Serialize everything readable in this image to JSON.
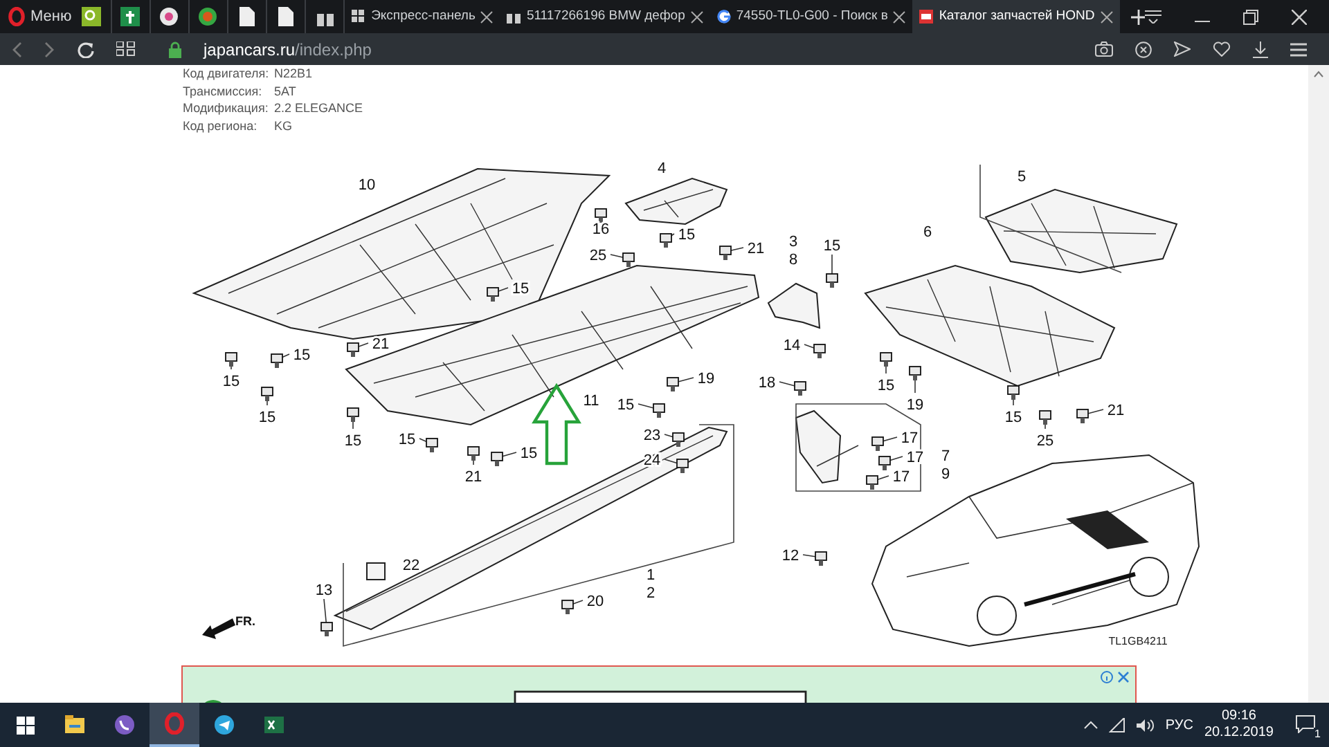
{
  "browser": {
    "menu_label": "Меню",
    "tabs": [
      {
        "title": "Экспресс-панель",
        "kind": "speed-dial",
        "selected": false
      },
      {
        "title": "51117266196 BMW дефор",
        "kind": "site",
        "selected": false
      },
      {
        "title": "74550-TL0-G00 - Поиск в",
        "kind": "google",
        "selected": false
      },
      {
        "title": "Каталог запчастей HOND",
        "kind": "catalog",
        "selected": true
      }
    ],
    "address": {
      "host": "japancars.ru",
      "path": "/index.php"
    }
  },
  "vehicle_info": [
    {
      "label": "Код двигателя:",
      "value": "N22B1"
    },
    {
      "label": "Трансмиссия:",
      "value": "5AT"
    },
    {
      "label": "Модификация:",
      "value": "2.2 ELEGANCE"
    },
    {
      "label": "Код региона:",
      "value": "KG"
    }
  ],
  "diagram": {
    "callouts": [
      "10",
      "16",
      "4",
      "15",
      "25",
      "21",
      "15",
      "21",
      "15",
      "15",
      "15",
      "19",
      "11",
      "15",
      "15",
      "15",
      "15",
      "21",
      "23",
      "24",
      "22",
      "13",
      "1",
      "2",
      "20",
      "5",
      "3",
      "8",
      "15",
      "6",
      "14",
      "18",
      "15",
      "19",
      "15",
      "21",
      "17",
      "25",
      "17",
      "7",
      "17",
      "9",
      "12"
    ],
    "direction_label": "FR.",
    "drawing_code": "TL1GB4211"
  },
  "taskbar": {
    "apps": [
      {
        "kind": "explorer",
        "selected": false
      },
      {
        "kind": "viber",
        "selected": false
      },
      {
        "kind": "opera",
        "selected": true
      },
      {
        "kind": "telegram",
        "selected": false
      },
      {
        "kind": "excel",
        "selected": false
      }
    ],
    "language": "РУС",
    "time": "09:16",
    "date": "20.12.2019",
    "notifications": "1"
  }
}
